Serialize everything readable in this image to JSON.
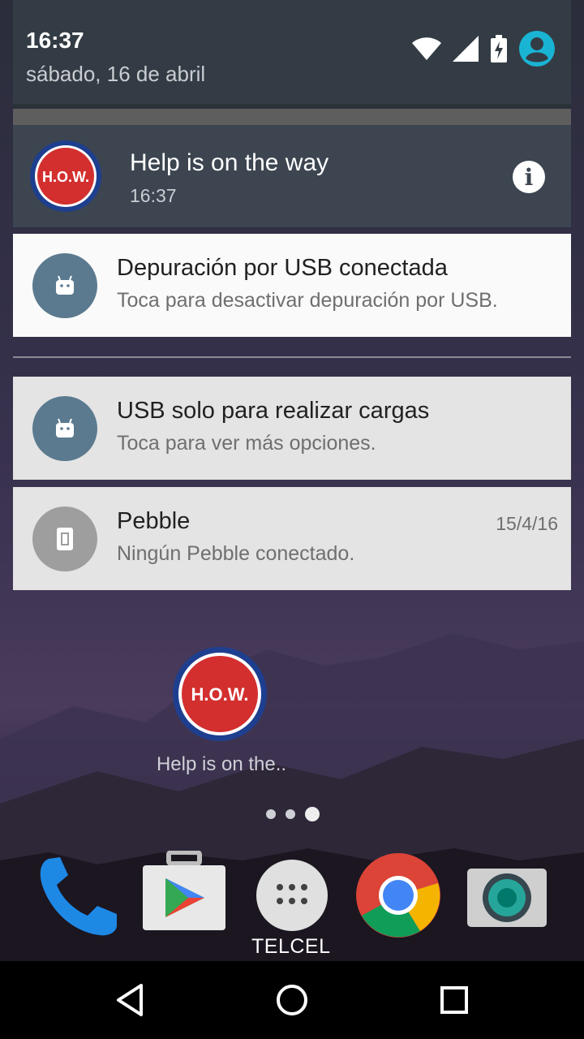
{
  "status": {
    "time": "16:37",
    "date": "sábado, 16 de abril",
    "icons": [
      "wifi-icon",
      "signal-icon",
      "battery-charging-icon",
      "user-avatar-icon"
    ]
  },
  "notifications": {
    "how": {
      "title": "Help is on the way",
      "time": "16:37",
      "logo_text": "H.O.W.",
      "icon": "info-icon"
    },
    "usb_debug": {
      "title": "Depuración por USB conectada",
      "text": "Toca para desactivar depuración por USB."
    },
    "usb_charge": {
      "title": "USB solo para realizar cargas",
      "text": "Toca para ver más opciones."
    },
    "pebble": {
      "title": "Pebble",
      "text": "Ningún Pebble conectado.",
      "time": "15/4/16"
    }
  },
  "home": {
    "app_label": "Help is on the..",
    "app_logo_text": "H.O.W.",
    "dock": [
      "phone-icon",
      "play-store-icon",
      "app-drawer-icon",
      "chrome-icon",
      "camera-icon"
    ],
    "carrier": "TELCEL",
    "page_dots": 3,
    "active_page": 3
  },
  "colors": {
    "header_bg": "#333c44",
    "how_card_bg": "#3c4550",
    "android_icon_bg": "#5b7a8f",
    "pebble_icon_bg": "#9e9e9e",
    "how_red": "#d32f2f",
    "how_blue": "#1e3f8f"
  }
}
